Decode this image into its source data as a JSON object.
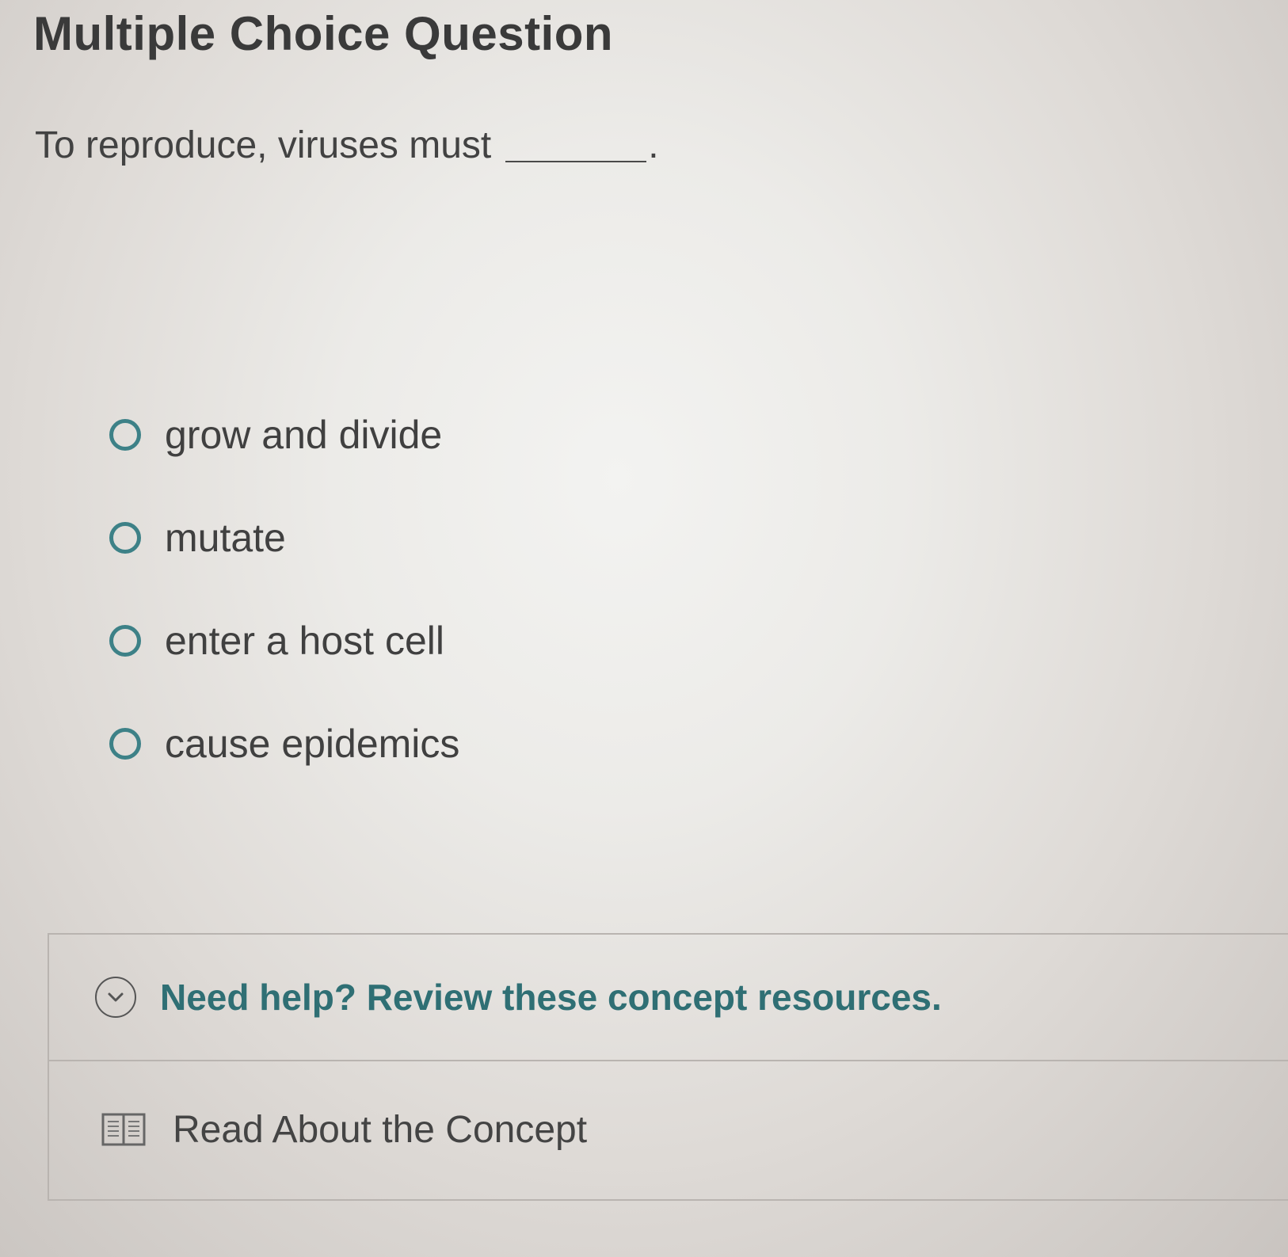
{
  "page": {
    "title": "Multiple Choice Question"
  },
  "question": {
    "text": "To reproduce, viruses must",
    "end_punctuation": "."
  },
  "options": [
    {
      "label": "grow and divide",
      "selected": false
    },
    {
      "label": "mutate",
      "selected": false
    },
    {
      "label": "enter a host cell",
      "selected": false
    },
    {
      "label": "cause epidemics",
      "selected": false
    }
  ],
  "help": {
    "title": "Need help? Review these concept resources.",
    "resources": [
      {
        "label": "Read About the Concept",
        "icon": "book-icon"
      }
    ]
  },
  "colors": {
    "accent_teal": "#3d8187",
    "help_title": "#2f6f74"
  }
}
